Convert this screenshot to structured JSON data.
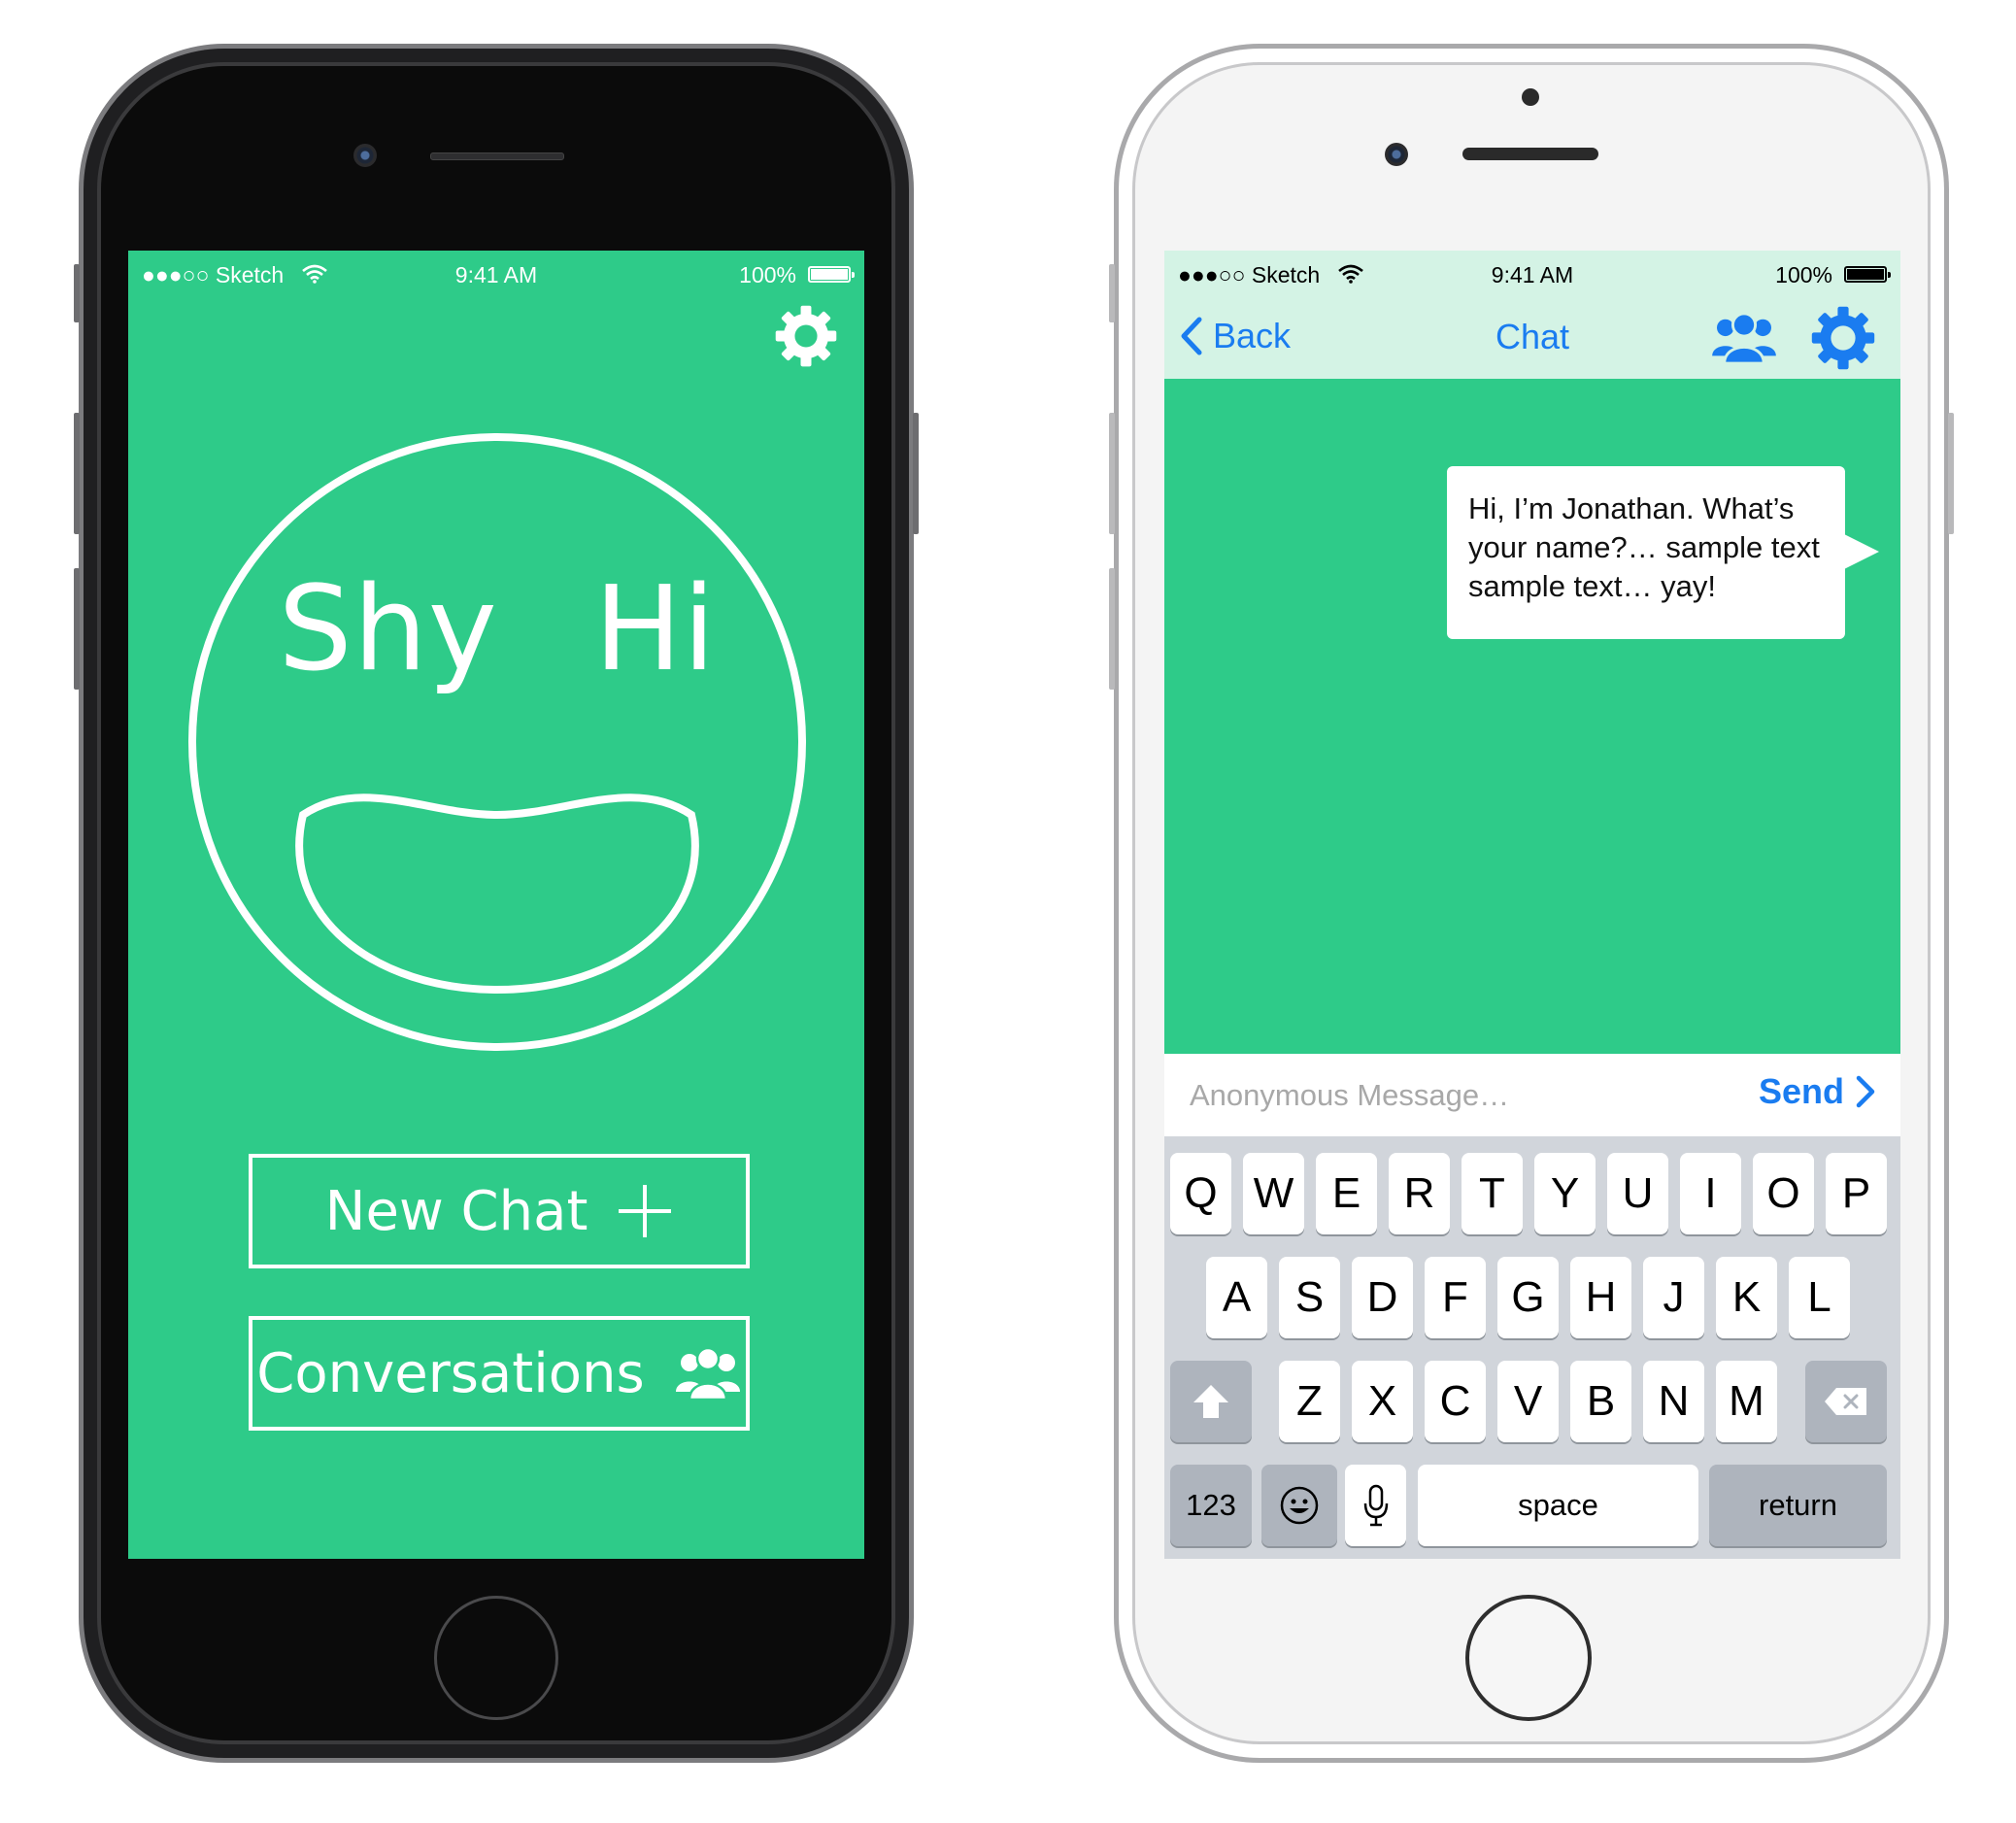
{
  "status_bar": {
    "carrier": "●●●○○ Sketch",
    "time": "9:41 AM",
    "battery_pct": "100%"
  },
  "home_screen": {
    "logo_text": "Shy Hi",
    "new_chat_label": "New Chat",
    "conversations_label": "Conversations",
    "icons": [
      "gear-icon",
      "plus-icon",
      "people-icon"
    ]
  },
  "chat_screen": {
    "back_label": "Back",
    "title": "Chat",
    "message": "Hi, I’m Jonathan. What’s your name?… sample text sample text… yay!",
    "input_placeholder": "Anonymous Message…",
    "send_label": "Send"
  },
  "keyboard": {
    "row1": [
      "Q",
      "W",
      "E",
      "R",
      "T",
      "Y",
      "U",
      "I",
      "O",
      "P"
    ],
    "row2": [
      "A",
      "S",
      "D",
      "F",
      "G",
      "H",
      "J",
      "K",
      "L"
    ],
    "row3": [
      "Z",
      "X",
      "C",
      "V",
      "B",
      "N",
      "M"
    ],
    "numbers_label": "123",
    "space_label": "space",
    "return_label": "return"
  },
  "colors": {
    "accent_green": "#2ecb89",
    "nav_bg": "#d4f3e5",
    "link_blue": "#1a7cf0",
    "keyboard_bg": "#d1d5db"
  }
}
